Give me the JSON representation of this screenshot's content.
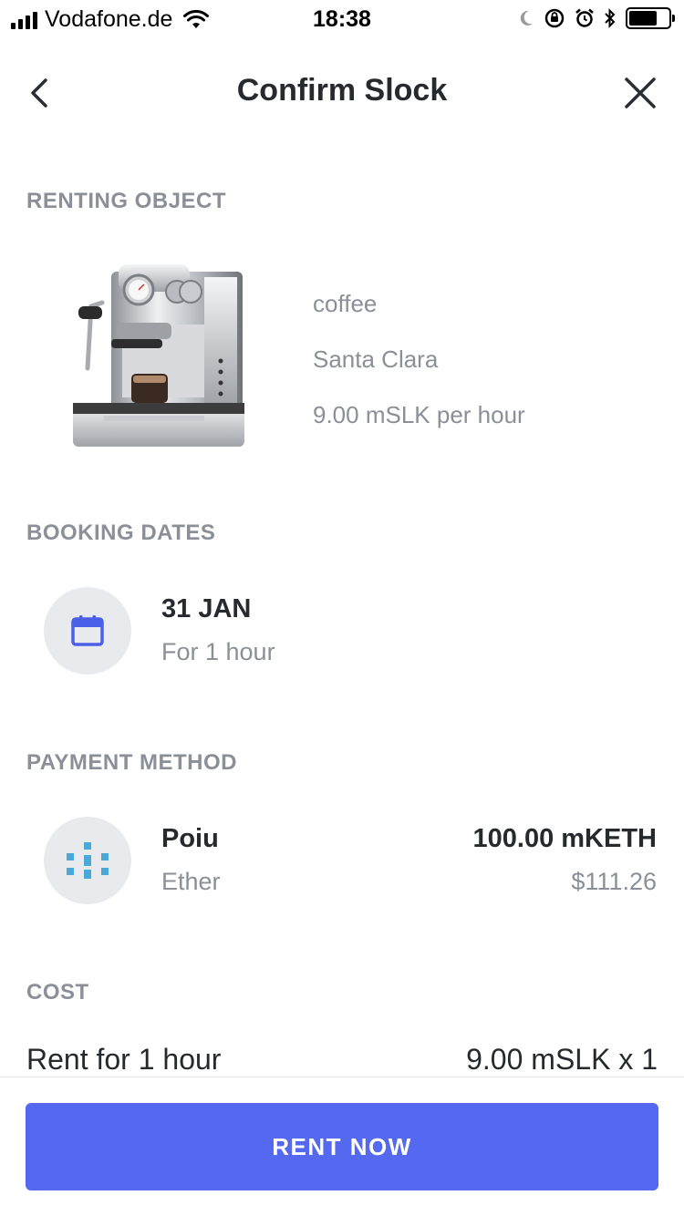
{
  "status_bar": {
    "carrier": "Vodafone.de",
    "time": "18:38"
  },
  "nav": {
    "title": "Confirm Slock",
    "back_icon": "chevron-left-icon",
    "close_icon": "close-icon"
  },
  "renting_object": {
    "label": "RENTING OBJECT",
    "name": "coffee",
    "location": "Santa Clara",
    "price": "9.00 mSLK per hour"
  },
  "booking_dates": {
    "label": "BOOKING DATES",
    "date": "31 JAN",
    "duration": "For 1 hour",
    "icon": "calendar-icon"
  },
  "payment_method": {
    "label": "PAYMENT METHOD",
    "wallet_name": "Poiu",
    "currency": "Ether",
    "amount": "100.00 mKETH",
    "amount_usd": "$111.26",
    "icon": "ether-wallet-icon"
  },
  "cost": {
    "label": "COST",
    "rent_label": "Rent for 1 hour",
    "rent_value": "9.00 mSLK x 1"
  },
  "action": {
    "rent_now_label": "RENT NOW"
  },
  "colors": {
    "accent": "#5468f0",
    "muted": "#8a8f98",
    "text": "#26292e",
    "icon_circle": "#e8eaee",
    "ether_blue": "#4aa8d8"
  }
}
